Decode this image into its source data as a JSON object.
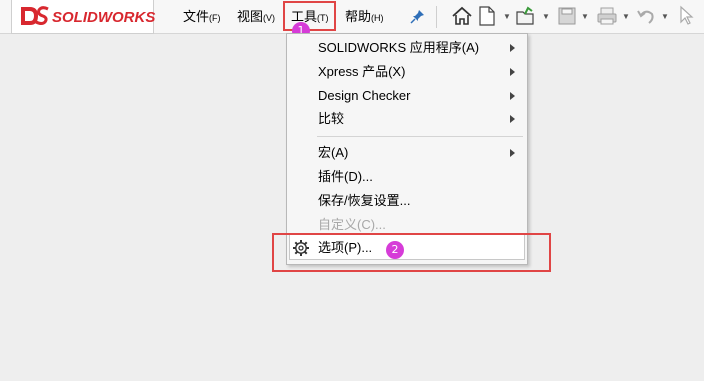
{
  "app": {
    "logo_text": "SOLIDWORKS"
  },
  "menubar": {
    "items": [
      {
        "label": "文件",
        "accel": "(F)"
      },
      {
        "label": "视图",
        "accel": "(V)"
      },
      {
        "label": "工具",
        "accel": "(T)"
      },
      {
        "label": "帮助",
        "accel": "(H)"
      }
    ]
  },
  "toolbar": {
    "icons": [
      "home-icon",
      "new-document-icon",
      "open-folder-icon",
      "save-icon",
      "print-icon",
      "undo-icon",
      "select-cursor-icon",
      "pin-icon"
    ]
  },
  "tools_menu": {
    "items": [
      {
        "label": "SOLIDWORKS 应用程序(A)",
        "submenu": true,
        "enabled": true
      },
      {
        "label": "Xpress 产品(X)",
        "submenu": true,
        "enabled": true
      },
      {
        "label": "Design Checker",
        "submenu": true,
        "enabled": true
      },
      {
        "label": "比较",
        "submenu": true,
        "enabled": true
      },
      {
        "label": "宏(A)",
        "submenu": true,
        "enabled": true
      },
      {
        "label": "插件(D)...",
        "submenu": false,
        "enabled": true
      },
      {
        "label": "保存/恢复设置...",
        "submenu": false,
        "enabled": true
      },
      {
        "label": "自定义(C)...",
        "submenu": false,
        "enabled": false
      },
      {
        "label": "选项(P)...",
        "submenu": false,
        "enabled": true,
        "highlighted": true
      }
    ]
  },
  "annotations": {
    "step1": "1",
    "step2": "2",
    "highlight_color": "#e04545",
    "badge_color": "#d63cd8"
  }
}
